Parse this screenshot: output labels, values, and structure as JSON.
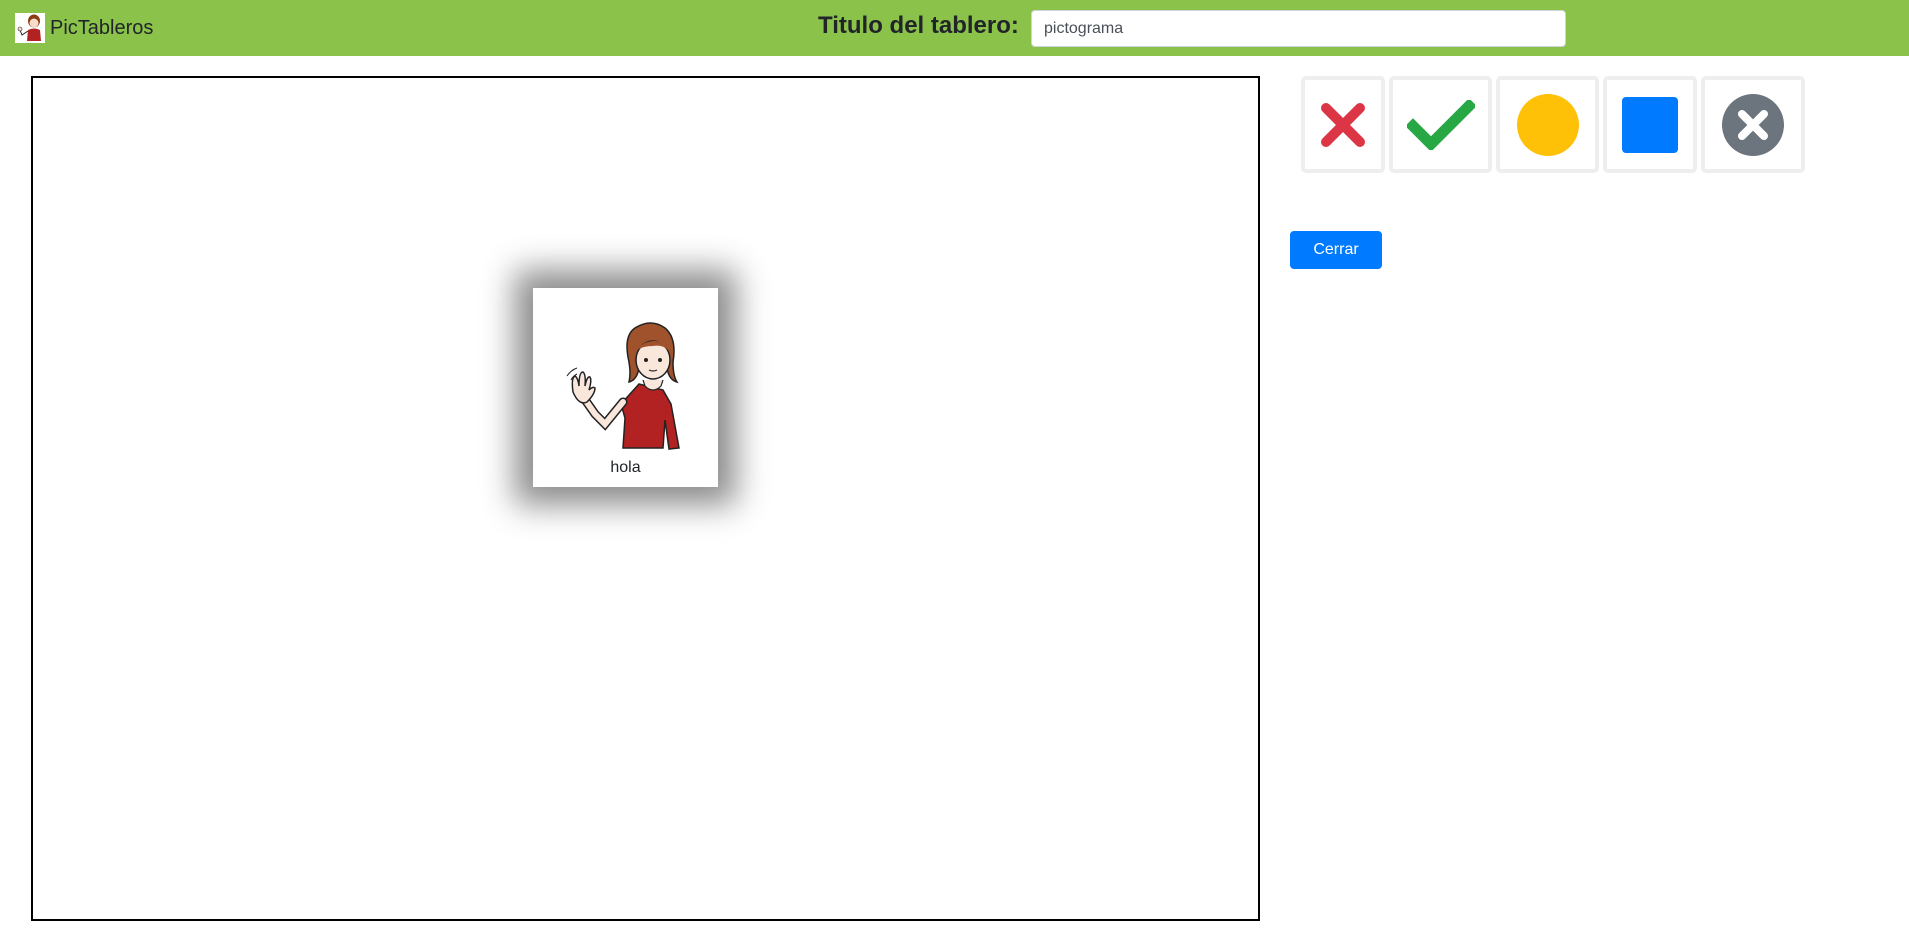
{
  "navbar": {
    "brand_text": "PicTableros",
    "brand_logo_icon": "girl-waving-logo",
    "title_label": "Titulo del tablero:",
    "title_value": "pictograma",
    "background_color": "#8bc34a"
  },
  "board": {
    "pictograms": [
      {
        "label": "hola",
        "icon": "girl-waving-hello-pictogram"
      }
    ]
  },
  "tools": [
    {
      "name": "red-x-icon",
      "color": "#dc3545"
    },
    {
      "name": "green-check-icon",
      "color": "#28a745"
    },
    {
      "name": "yellow-circle-icon",
      "color": "#ffc107"
    },
    {
      "name": "blue-square-icon",
      "color": "#007bff"
    },
    {
      "name": "gray-circle-x-icon",
      "color": "#6c757d"
    }
  ],
  "actions": {
    "close_label": "Cerrar",
    "close_color": "#007bff"
  }
}
